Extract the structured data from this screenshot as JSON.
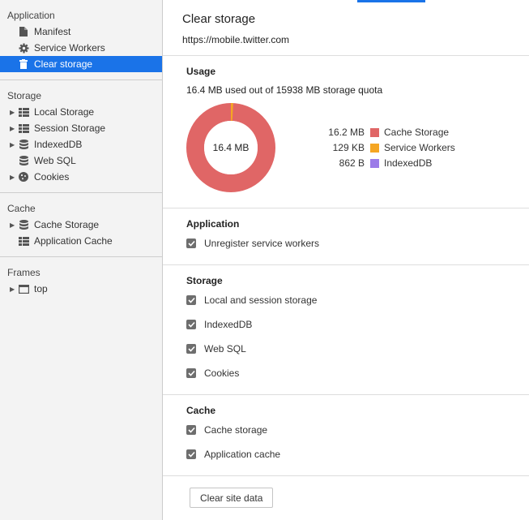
{
  "colors": {
    "accent": "#1a73e8",
    "cache_storage": "#e06666",
    "service_workers": "#f5a623",
    "indexeddb": "#9b7be8"
  },
  "sidebar": {
    "sections": [
      {
        "label": "Application",
        "items": [
          {
            "label": "Manifest",
            "icon": "file-icon"
          },
          {
            "label": "Service Workers",
            "icon": "gear-icon"
          },
          {
            "label": "Clear storage",
            "icon": "trash-icon"
          }
        ]
      },
      {
        "label": "Storage",
        "items": [
          {
            "label": "Local Storage",
            "icon": "grid-icon"
          },
          {
            "label": "Session Storage",
            "icon": "grid-icon"
          },
          {
            "label": "IndexedDB",
            "icon": "database-icon"
          },
          {
            "label": "Web SQL",
            "icon": "database-icon"
          },
          {
            "label": "Cookies",
            "icon": "cookie-icon"
          }
        ]
      },
      {
        "label": "Cache",
        "items": [
          {
            "label": "Cache Storage",
            "icon": "database-icon"
          },
          {
            "label": "Application Cache",
            "icon": "grid-icon"
          }
        ]
      },
      {
        "label": "Frames",
        "items": [
          {
            "label": "top",
            "icon": "frame-icon"
          }
        ]
      }
    ]
  },
  "main": {
    "title": "Clear storage",
    "origin": "https://mobile.twitter.com",
    "usage": {
      "heading": "Usage",
      "quota_text": "16.4 MB used out of 15938 MB storage quota",
      "total_label": "16.4 MB",
      "legend": [
        {
          "size": "16.2 MB",
          "name": "Cache Storage"
        },
        {
          "size": "129 KB",
          "name": "Service Workers"
        },
        {
          "size": "862 B",
          "name": "IndexedDB"
        }
      ]
    },
    "application": {
      "heading": "Application",
      "options": [
        "Unregister service workers"
      ]
    },
    "storage": {
      "heading": "Storage",
      "options": [
        "Local and session storage",
        "IndexedDB",
        "Web SQL",
        "Cookies"
      ]
    },
    "cache": {
      "heading": "Cache",
      "options": [
        "Cache storage",
        "Application cache"
      ]
    },
    "clear_button": "Clear site data"
  }
}
